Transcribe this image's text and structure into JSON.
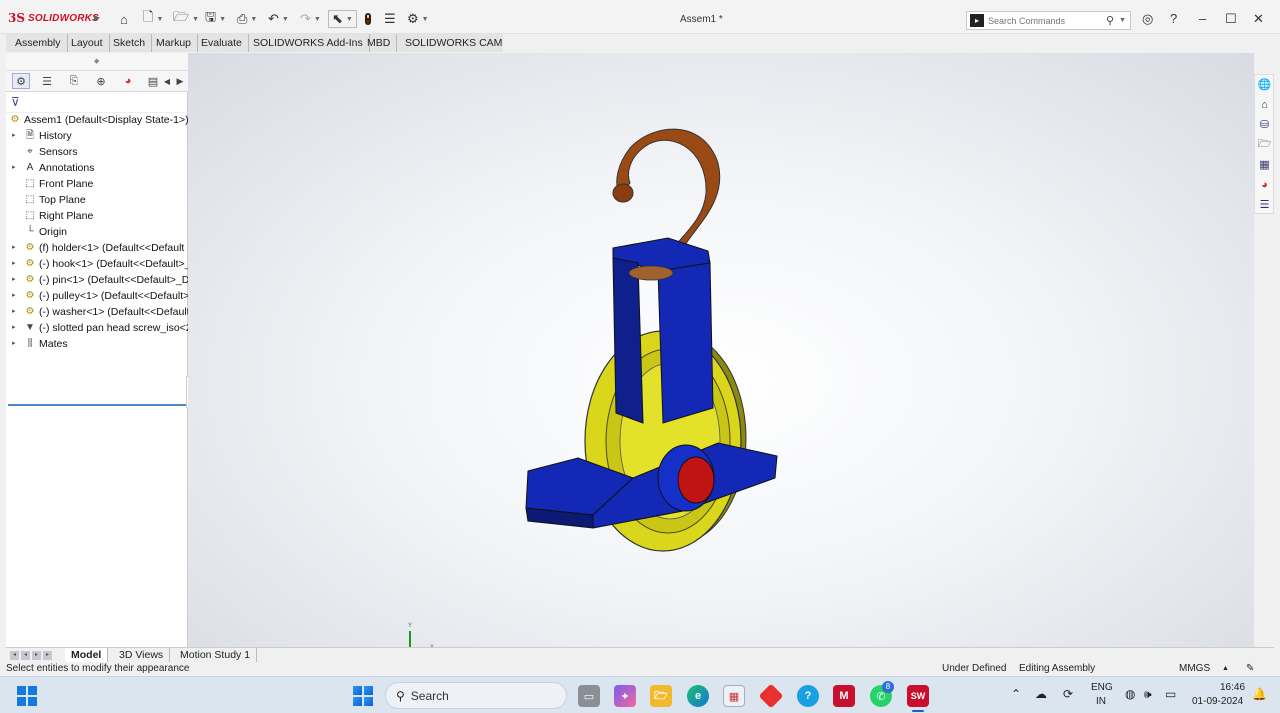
{
  "app": {
    "logo_ds": "3S",
    "logo_text": "SOLIDWORKS",
    "document_title": "Assem1 *"
  },
  "quick_access": {
    "icons": [
      "home-icon",
      "new-document-icon",
      "open-folder-icon",
      "save-icon",
      "print-icon",
      "undo-icon",
      "redo-icon",
      "select-icon",
      "rebuild-icon",
      "file-properties-icon",
      "options-gear-icon"
    ]
  },
  "search": {
    "placeholder": "Search Commands"
  },
  "command_tabs": [
    "Assembly",
    "Layout",
    "Sketch",
    "Markup",
    "Evaluate",
    "SOLIDWORKS Add-Ins",
    "MBD",
    "SOLIDWORKS CAM"
  ],
  "feature_tree": {
    "root": "Assem1  (Default<Display State-1>)",
    "items": [
      {
        "label": "History",
        "icon": "history-icon",
        "arrow": true
      },
      {
        "label": "Sensors",
        "icon": "sensors-icon",
        "arrow": false
      },
      {
        "label": "Annotations",
        "icon": "annotations-icon",
        "arrow": true
      },
      {
        "label": "Front Plane",
        "icon": "plane-icon",
        "arrow": false
      },
      {
        "label": "Top Plane",
        "icon": "plane-icon",
        "arrow": false
      },
      {
        "label": "Right Plane",
        "icon": "plane-icon",
        "arrow": false
      },
      {
        "label": "Origin",
        "icon": "origin-icon",
        "arrow": false
      },
      {
        "label": "(f) holder<1> (Default<<Default",
        "icon": "part-icon",
        "arrow": true
      },
      {
        "label": "(-) hook<1> (Default<<Default>_",
        "icon": "part-icon",
        "arrow": true
      },
      {
        "label": "(-) pin<1> (Default<<Default>_D",
        "icon": "part-icon",
        "arrow": true
      },
      {
        "label": "(-) pulley<1> (Default<<Default>",
        "icon": "part-icon",
        "arrow": true
      },
      {
        "label": "(-) washer<1> (Default<<Default",
        "icon": "part-icon",
        "arrow": true
      },
      {
        "label": "(-) slotted pan head screw_iso<2",
        "icon": "screw-icon",
        "arrow": true
      },
      {
        "label": "Mates",
        "icon": "mates-icon",
        "arrow": true
      }
    ]
  },
  "bottom_tabs": [
    "Model",
    "3D Views",
    "Motion Study 1"
  ],
  "status": {
    "message": "Select entities to modify their appearance",
    "constraint": "Under Defined",
    "mode": "Editing Assembly",
    "units": "MMGS"
  },
  "taskbar": {
    "search_label": "Search",
    "lang_line1": "ENG",
    "lang_line2": "IN",
    "time": "16:46",
    "date": "01-09-2024",
    "whatsapp_badge": "8"
  },
  "colors": {
    "holder": "#1328b4",
    "hook": "#9a4a14",
    "pulley": "#d9d61c",
    "pin": "#c01414",
    "accent": "#d0102a"
  }
}
